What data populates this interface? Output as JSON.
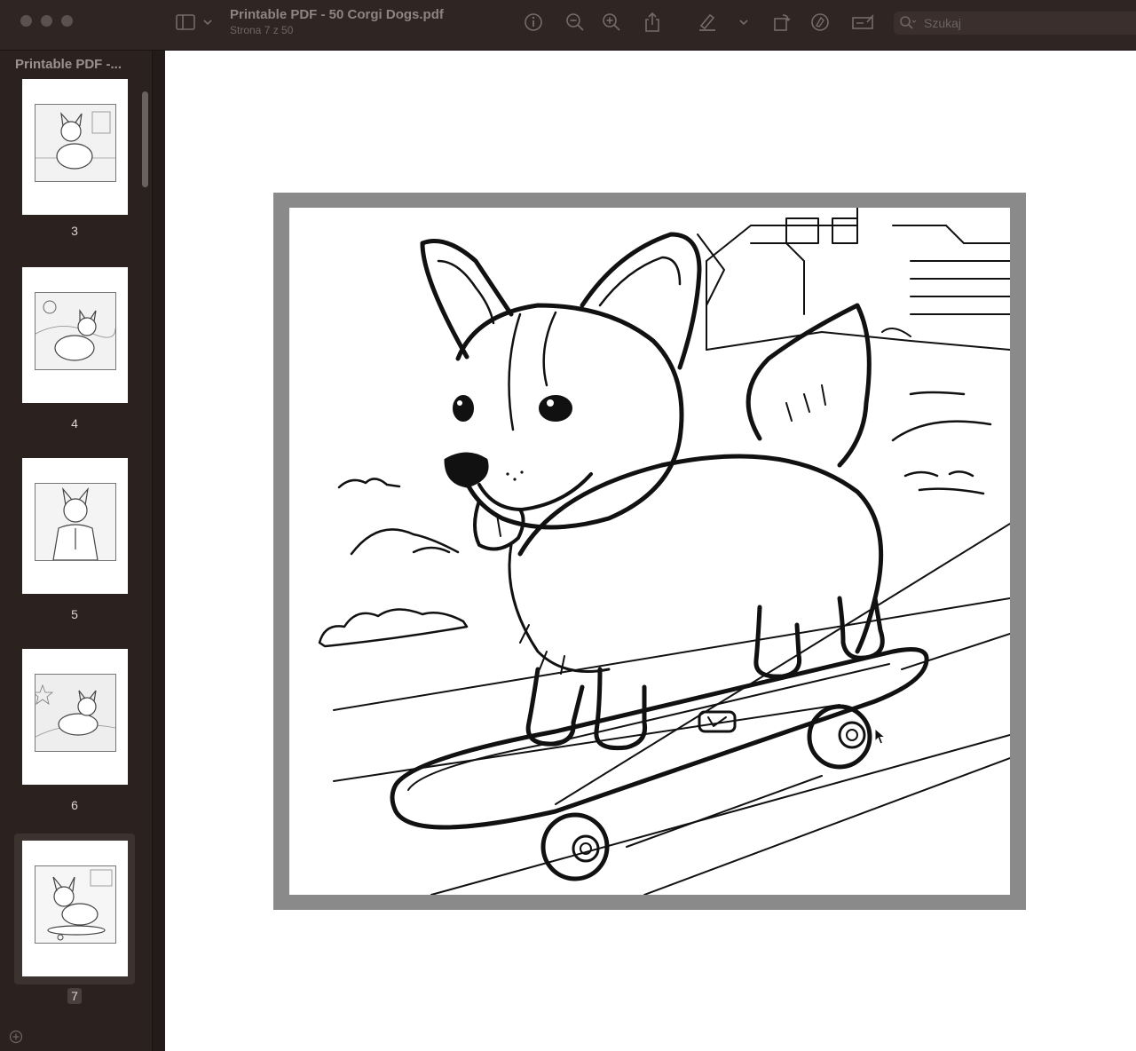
{
  "window": {
    "title": "Printable PDF - 50 Corgi Dogs.pdf",
    "subtitle": "Strona 7 z 50"
  },
  "toolbar": {
    "icons": [
      "sidebar-toggle-icon",
      "chevron-down-icon",
      "info-icon",
      "zoom-out-icon",
      "zoom-in-icon",
      "share-icon",
      "highlight-pen-icon",
      "chevron-down-icon",
      "rotate-icon",
      "markup-icon",
      "form-fill-icon",
      "search-icon"
    ],
    "search_placeholder": "Szukaj"
  },
  "sidebar": {
    "title": "Printable PDF -...",
    "thumbnails": [
      {
        "label": "3"
      },
      {
        "label": "4"
      },
      {
        "label": "5"
      },
      {
        "label": "6"
      },
      {
        "label": "7",
        "selected": true
      }
    ]
  },
  "colors": {
    "chrome": "#2b2220",
    "frame": "#8a8a8a",
    "page": "#ffffff"
  }
}
